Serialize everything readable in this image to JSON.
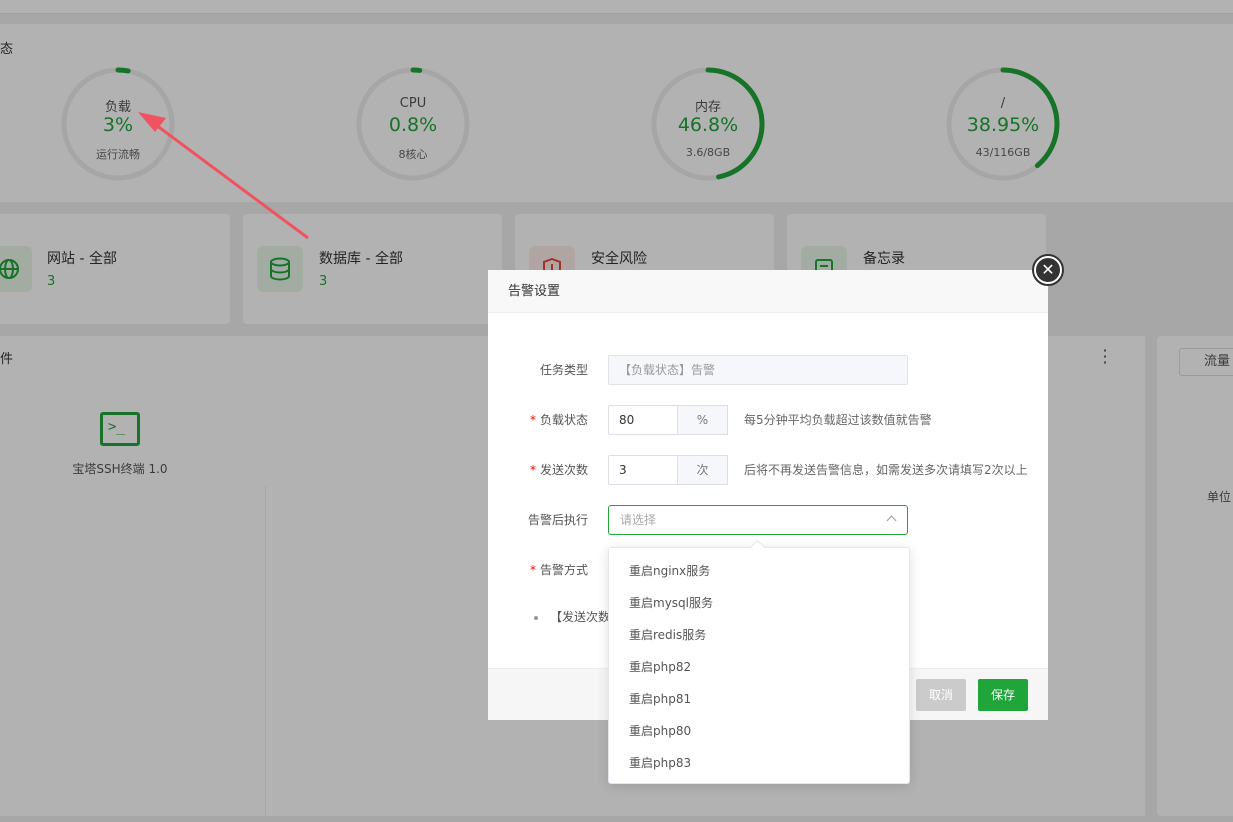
{
  "status_panel": {
    "title": "状态",
    "gauges": [
      {
        "label": "负载",
        "value": "3%",
        "sub": "运行流畅",
        "percent": 3
      },
      {
        "label": "CPU",
        "value": "0.8%",
        "sub": "8核心",
        "percent": 0.8
      },
      {
        "label": "内存",
        "value": "46.8%",
        "sub": "3.6/8GB",
        "percent": 46.8
      },
      {
        "label": "/",
        "value": "38.95%",
        "sub": "43/116GB",
        "percent": 38.95
      }
    ]
  },
  "overview_cards": [
    {
      "title": "网站 - 全部",
      "count": "3",
      "icon": "globe-icon"
    },
    {
      "title": "数据库 - 全部",
      "count": "3",
      "icon": "database-icon"
    },
    {
      "title": "安全风险",
      "count": "",
      "icon": "shield-icon"
    },
    {
      "title": "备忘录",
      "count": "",
      "icon": "memo-icon"
    }
  ],
  "software_panel": {
    "title": "软件",
    "items": [
      {
        "name": "宝塔SSH终端 1.0",
        "icon": "terminal-icon"
      }
    ]
  },
  "flow_panel": {
    "tab": "流量",
    "unit": "单位"
  },
  "modal": {
    "title": "告警设置",
    "task_type": {
      "label": "任务类型",
      "value": "【负载状态】告警"
    },
    "load_status": {
      "label": "负载状态",
      "value": "80",
      "unit": "%",
      "hint": "每5分钟平均负载超过该数值就告警"
    },
    "send_count": {
      "label": "发送次数",
      "value": "3",
      "unit": "次",
      "hint": "后将不再发送告警信息，如需发送多次请填写2次以上"
    },
    "after_alert": {
      "label": "告警后执行",
      "placeholder": "请选择"
    },
    "alert_method": {
      "label": "告警方式"
    },
    "note": "【发送次数",
    "cancel_label": "取消",
    "save_label": "保存"
  },
  "dropdown_options": [
    "重启nginx服务",
    "重启mysql服务",
    "重启redis服务",
    "重启php82",
    "重启php81",
    "重启php80",
    "重启php83"
  ],
  "colors": {
    "accent": "#20a53a",
    "arrow": "#f0535f"
  }
}
